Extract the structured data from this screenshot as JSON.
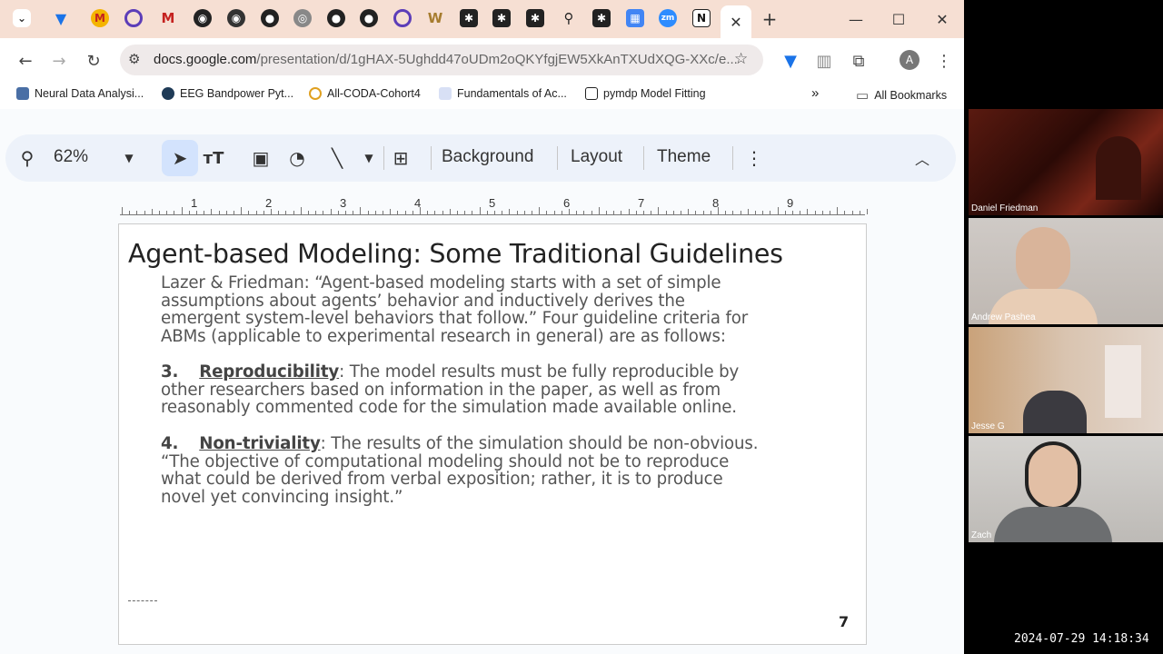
{
  "browser": {
    "url_host": "docs.google.com",
    "url_path": "/presentation/d/1gHAX-5Ughdd47oUDm2oQKYfgjEW5XkAnTXUdXQG-XXc/e...",
    "profile_initial": "A",
    "bookmarks": [
      {
        "label": "Neural Data Analysi..."
      },
      {
        "label": "EEG Bandpower Pyt..."
      },
      {
        "label": "All-CODA-Cohort4"
      },
      {
        "label": "Fundamentals of Ac..."
      },
      {
        "label": "pymdp Model Fitting"
      }
    ],
    "bookmarks_more": "»",
    "all_bookmarks": "All Bookmarks"
  },
  "toolbar": {
    "zoom": "62%",
    "background": "Background",
    "layout": "Layout",
    "theme": "Theme"
  },
  "ruler": [
    "1",
    "2",
    "3",
    "4",
    "5",
    "6",
    "7",
    "8",
    "9"
  ],
  "slide": {
    "title": "Agent-based Modeling: Some Traditional Guidelines",
    "intro": [
      "Lazer & Friedman: “Agent-based modeling starts with a set of simple",
      "assumptions about agents’ behavior and inductively derives the",
      "emergent system-level behaviors that follow.” Four guideline criteria for",
      "ABMs (applicable to experimental research in general) are as follows:"
    ],
    "item3_num": "3.",
    "item3_term": "Reproducibility",
    "item3_lines": [
      ": The model results must be fully reproducible by",
      "other researchers based on information in the paper, as well as from",
      "reasonably commented code for the simulation made available online."
    ],
    "item4_num": "4.",
    "item4_term": "Non-triviality",
    "item4_lines": [
      ": The results of the simulation should be non-obvious.",
      "“The objective of computational modeling should not be to reproduce",
      "what could be derived from verbal exposition; rather, it is to produce",
      "novel yet convincing insight.”"
    ],
    "page_number": "7"
  },
  "participants": [
    {
      "name": "Daniel Friedman"
    },
    {
      "name": "Andrew Pashea"
    },
    {
      "name": "Jesse G"
    },
    {
      "name": "Zach"
    }
  ],
  "timestamp": "2024-07-29  14:18:34"
}
